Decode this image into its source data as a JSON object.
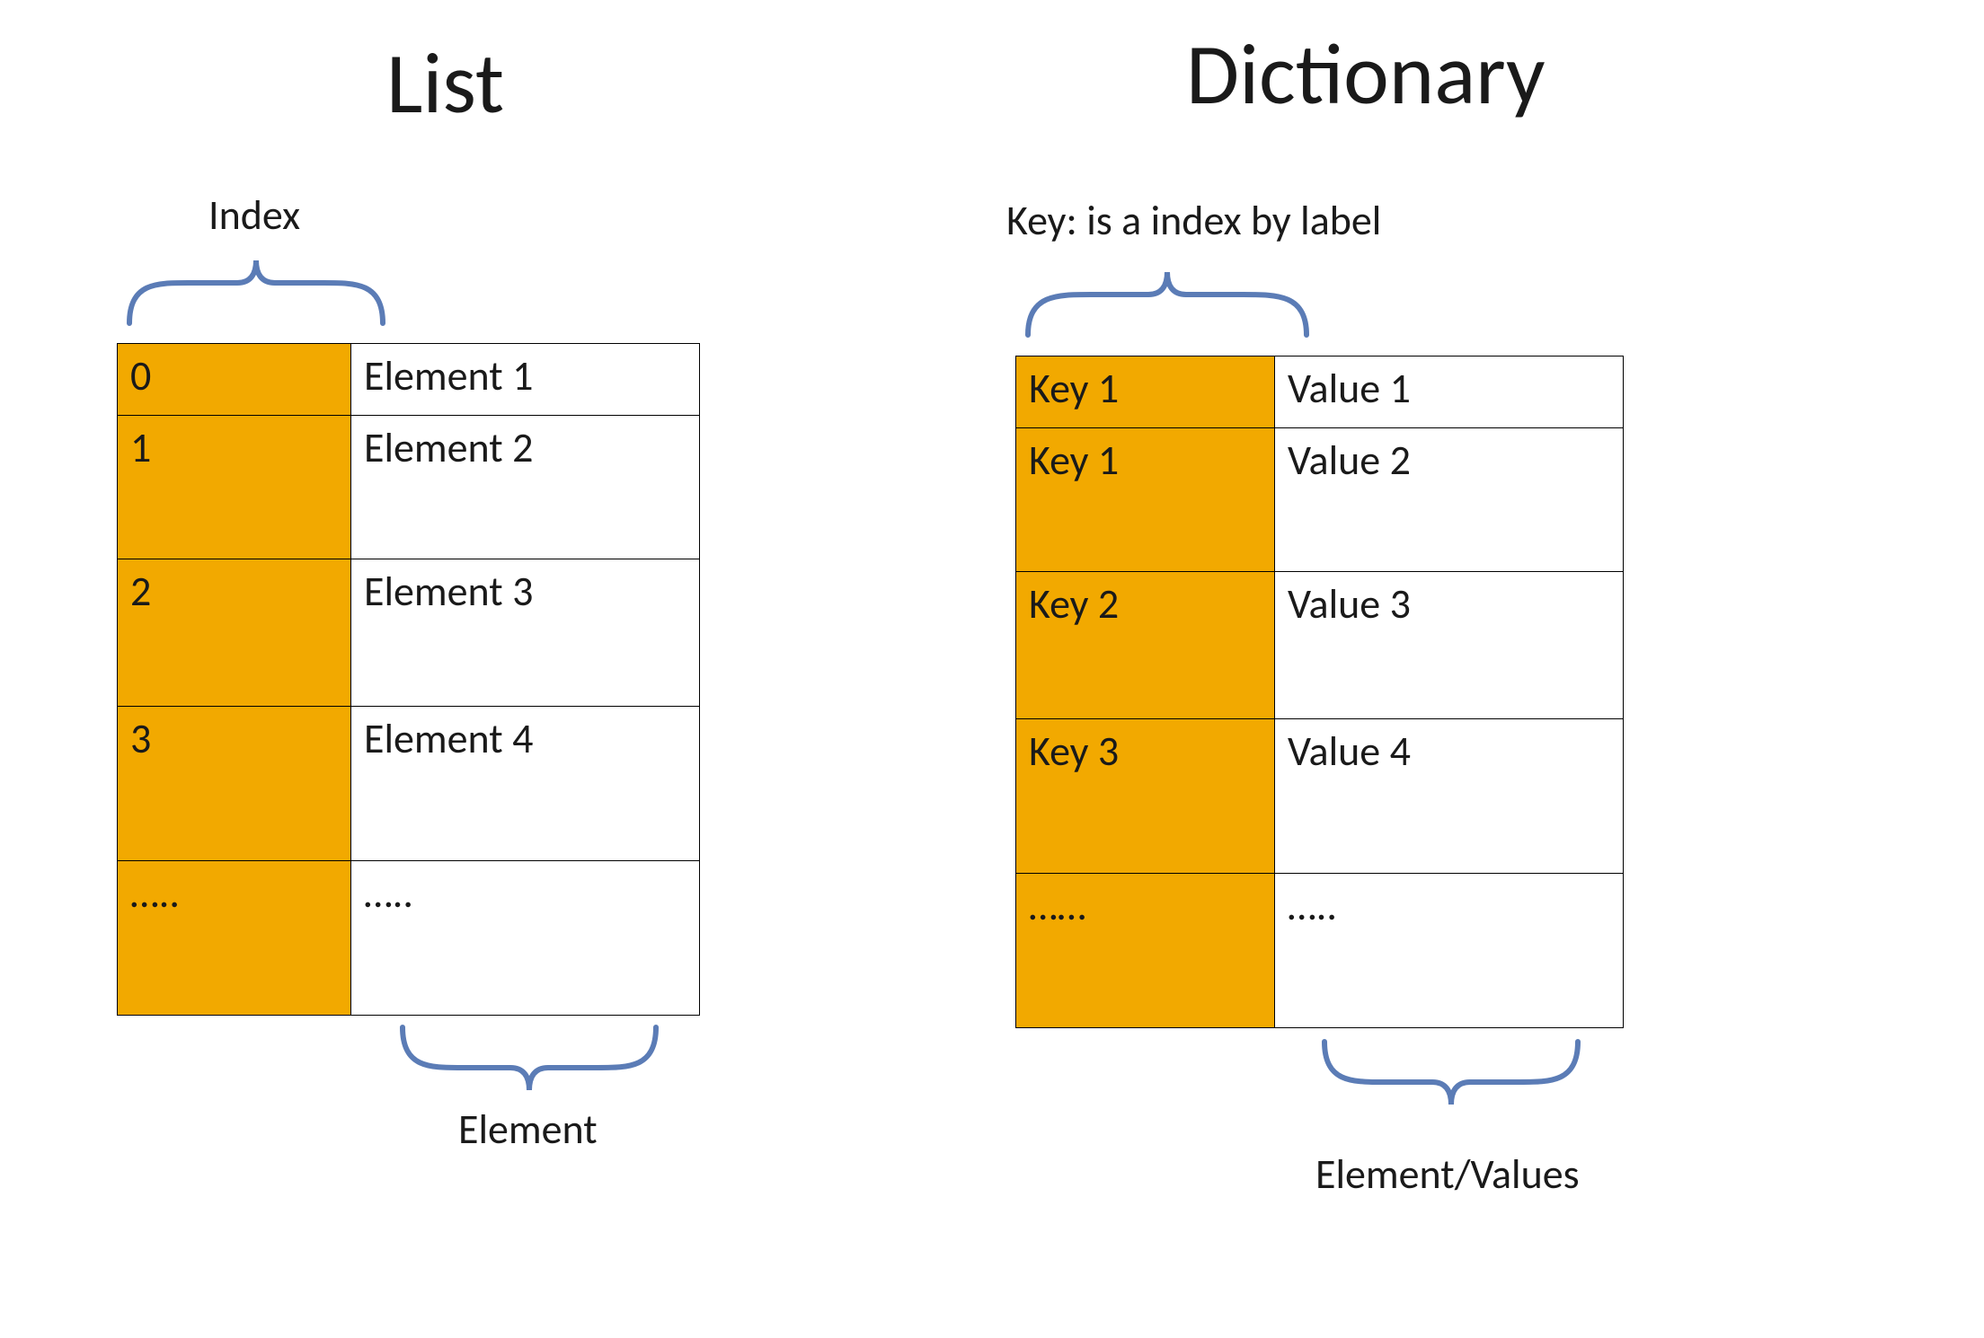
{
  "colors": {
    "highlight": "#f2a900",
    "brace": "#5b7cb6"
  },
  "list": {
    "title": "List",
    "top_label": "Index",
    "bottom_label": "Element",
    "rows": [
      {
        "index": "0",
        "value": "Element  1"
      },
      {
        "index": "1",
        "value": "Element  2"
      },
      {
        "index": "2",
        "value": "Element  3"
      },
      {
        "index": "3",
        "value": "Element  4"
      },
      {
        "index": "…..",
        "value": "….."
      }
    ]
  },
  "dictionary": {
    "title": "Dictionary",
    "top_label": "Key: is a index by label",
    "bottom_label": "Element/Values",
    "rows": [
      {
        "key": "Key 1",
        "value": "Value  1"
      },
      {
        "key": "Key 1",
        "value": "Value  2"
      },
      {
        "key": "Key 2",
        "value": "Value 3"
      },
      {
        "key": "Key 3",
        "value": "Value  4"
      },
      {
        "key": "……",
        "value": "….."
      }
    ]
  }
}
